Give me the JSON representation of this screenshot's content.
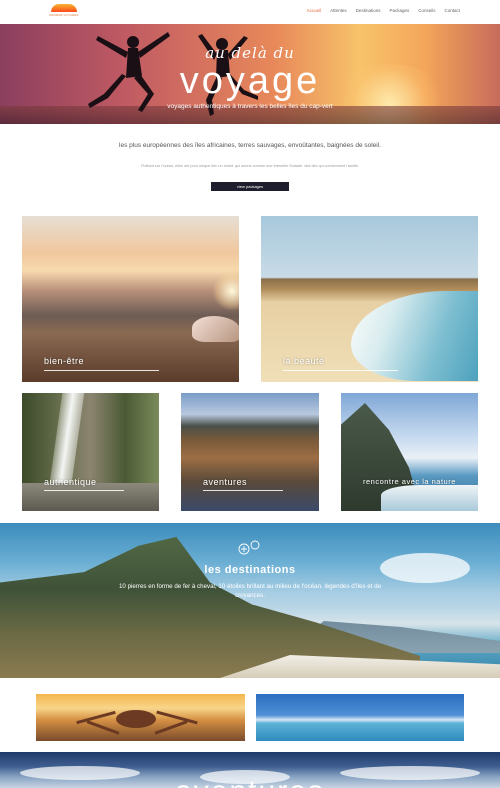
{
  "header": {
    "logo_tagline": "BAOBAB VOYAGES",
    "nav": [
      {
        "label": "Accueil",
        "active": true
      },
      {
        "label": "Attentes",
        "active": false
      },
      {
        "label": "Destinations",
        "active": false
      },
      {
        "label": "Packages",
        "active": false
      },
      {
        "label": "Conseils",
        "active": false
      },
      {
        "label": "Contact",
        "active": false
      }
    ]
  },
  "hero": {
    "script": "au delà du",
    "title": "voyage",
    "subtitle": "voyages authentiques à travers les belles îles du cap-vert"
  },
  "intro": {
    "text": "les plus européennes des îles africaines, terres sauvages, envoûtantes, baignées de soleil.",
    "small": "Flottant sur l'océan, elles ont pour unique lien un chant, qui sonne comme une éternelle Sodade. des îles qui conviennent l'amitié.",
    "button": "view packages"
  },
  "tiles": [
    {
      "label": "bien-être"
    },
    {
      "label": "la beauté"
    },
    {
      "label": "authentique"
    },
    {
      "label": "aventures"
    },
    {
      "label": "rencontre avec la nature"
    }
  ],
  "destinations": {
    "icon": "ship-icon",
    "title": "les destinations",
    "text": "10 pierres en forme de fer à cheval, 10 étoiles brillant au milieu de l'océan. légendes d'îles et de croyances."
  },
  "bottom": {
    "title": "aventures"
  },
  "colors": {
    "accent": "#e8663d",
    "button_bg": "#1e1d2e"
  }
}
